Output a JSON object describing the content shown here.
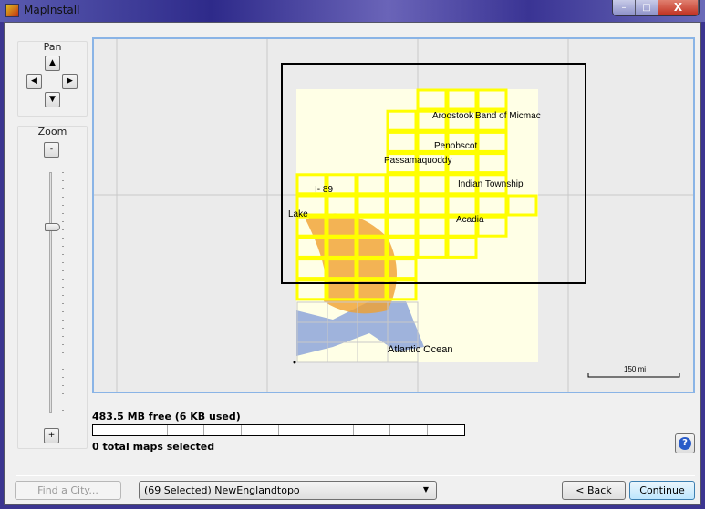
{
  "window": {
    "title": "MapInstall",
    "minimize": "–",
    "maximize": "□",
    "close": "X"
  },
  "pan": {
    "label": "Pan",
    "up": "▲",
    "down": "▼",
    "left": "◀",
    "right": "▶"
  },
  "zoom": {
    "label": "Zoom",
    "minus": "-",
    "plus": "+",
    "level_fraction": 0.22
  },
  "map": {
    "labels": [
      "Aroostook",
      "Band of Micmac",
      "Penobscot",
      "Passamaquoddy",
      "Indian Township",
      "I- 89",
      "Lake",
      "Acadia",
      "Atlantic Ocean"
    ],
    "scale": "150 mi",
    "colors": {
      "selected_tile": "#ffff00",
      "land": "#ffffe6",
      "water": "#9fb3dc",
      "roads": "#f0a030",
      "viewport": "#000000"
    }
  },
  "status": {
    "free": "483.5 MB free (6 KB used)",
    "selected": "0 total maps selected",
    "progress": 0
  },
  "footer": {
    "find_city": "Find a City...",
    "product": "(69 Selected) NewEnglandtopo",
    "back": "< Back",
    "continue": "Continue",
    "help": "?"
  }
}
